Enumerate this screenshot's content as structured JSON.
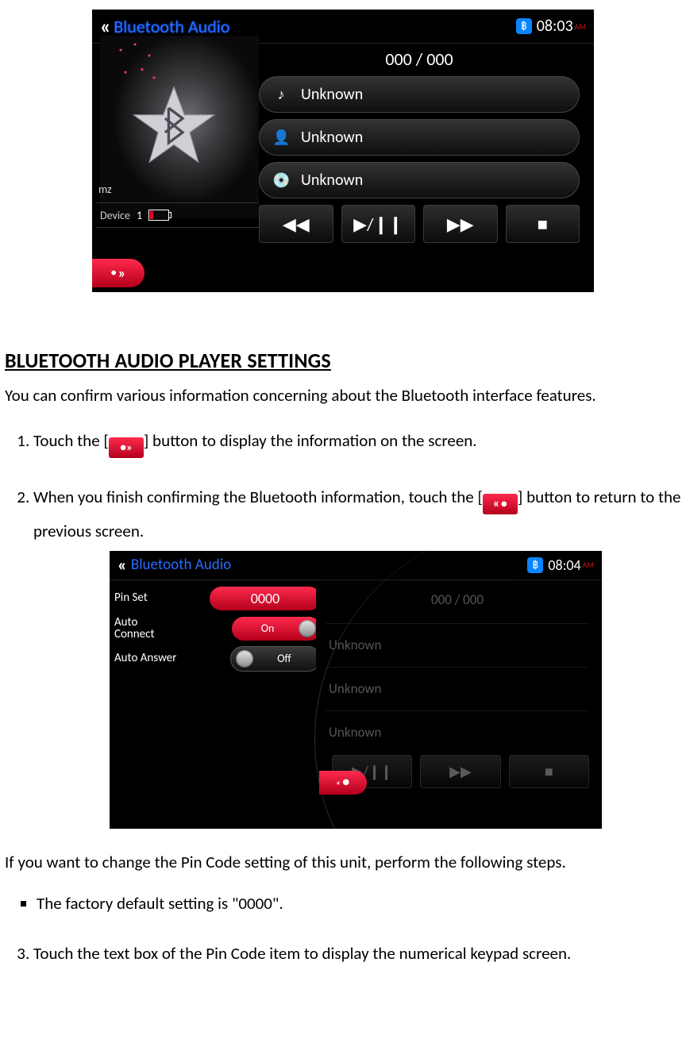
{
  "screenshot1": {
    "title": "Bluetooth Audio",
    "time": "08:03",
    "ampm": "AM",
    "artist_label": "mz",
    "device_label": "Device",
    "device_value": "1",
    "counter": "000 / 000",
    "rows": {
      "track": "Unknown",
      "artist": "Unknown",
      "album": "Unknown"
    }
  },
  "doc": {
    "heading": "BLUETOOTH AUDIO PLAYER SETTINGS",
    "intro": "You can confirm various information concerning about the Bluetooth interface features.",
    "step1a": "Touch the [",
    "step1b": "] button to display the information on the screen.",
    "step2a": "When you finish confirming the Bluetooth information, touch the [",
    "step2b": "] button to return to the previous screen.",
    "para2": "If you want to change the Pin Code setting of this unit, perform the following steps.",
    "bullet1": "The factory default setting is \"0000\".",
    "step3": "Touch the text box of the Pin Code item to display the numerical keypad screen."
  },
  "screenshot2": {
    "title": "Bluetooth Audio",
    "time": "08:04",
    "ampm": "AM",
    "pinset_label": "Pin Set",
    "pinset_value": "0000",
    "autoconnect_label": "Auto Connect",
    "autoconnect_value": "On",
    "autoanswer_label": "Auto Answer",
    "autoanswer_value": "Off",
    "counter": "000 / 000",
    "dim": {
      "track": "Unknown",
      "artist": "Unknown",
      "album": "Unknown"
    }
  }
}
